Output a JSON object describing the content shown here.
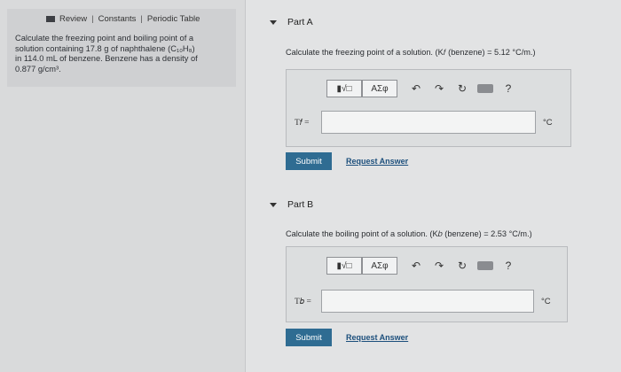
{
  "tabs": {
    "review": "Review",
    "constants": "Constants",
    "periodic_table": "Periodic Table",
    "separator": "|"
  },
  "problem": {
    "text": "Calculate the freezing point and boiling point of a\nsolution containing 17.8 g of naphthalene (C₁₀H₈)\nin 114.0 mL of benzene. Benzene has a density of\n0.877 g/cm³."
  },
  "part_a": {
    "title": "Part A",
    "question": "Calculate the freezing point of a solution. (K𝑓 (benzene) = 5.12 °C/m.)",
    "var_label": "T𝑓 =",
    "unit": "°C",
    "input_value": "",
    "submit_label": "Submit",
    "request_label": "Request Answer"
  },
  "part_b": {
    "title": "Part B",
    "question": "Calculate the boiling point of a solution. (K𝑏 (benzene) = 2.53 °C/m.)",
    "var_label": "T𝑏 =",
    "unit": "°C",
    "input_value": "",
    "submit_label": "Submit",
    "request_label": "Request Answer"
  },
  "toolbar": {
    "templates_label": "▮√□",
    "symbols_label": "ΑΣφ",
    "undo_glyph": "↶",
    "redo_glyph": "↷",
    "reset_glyph": "↻",
    "help_glyph": "?"
  }
}
